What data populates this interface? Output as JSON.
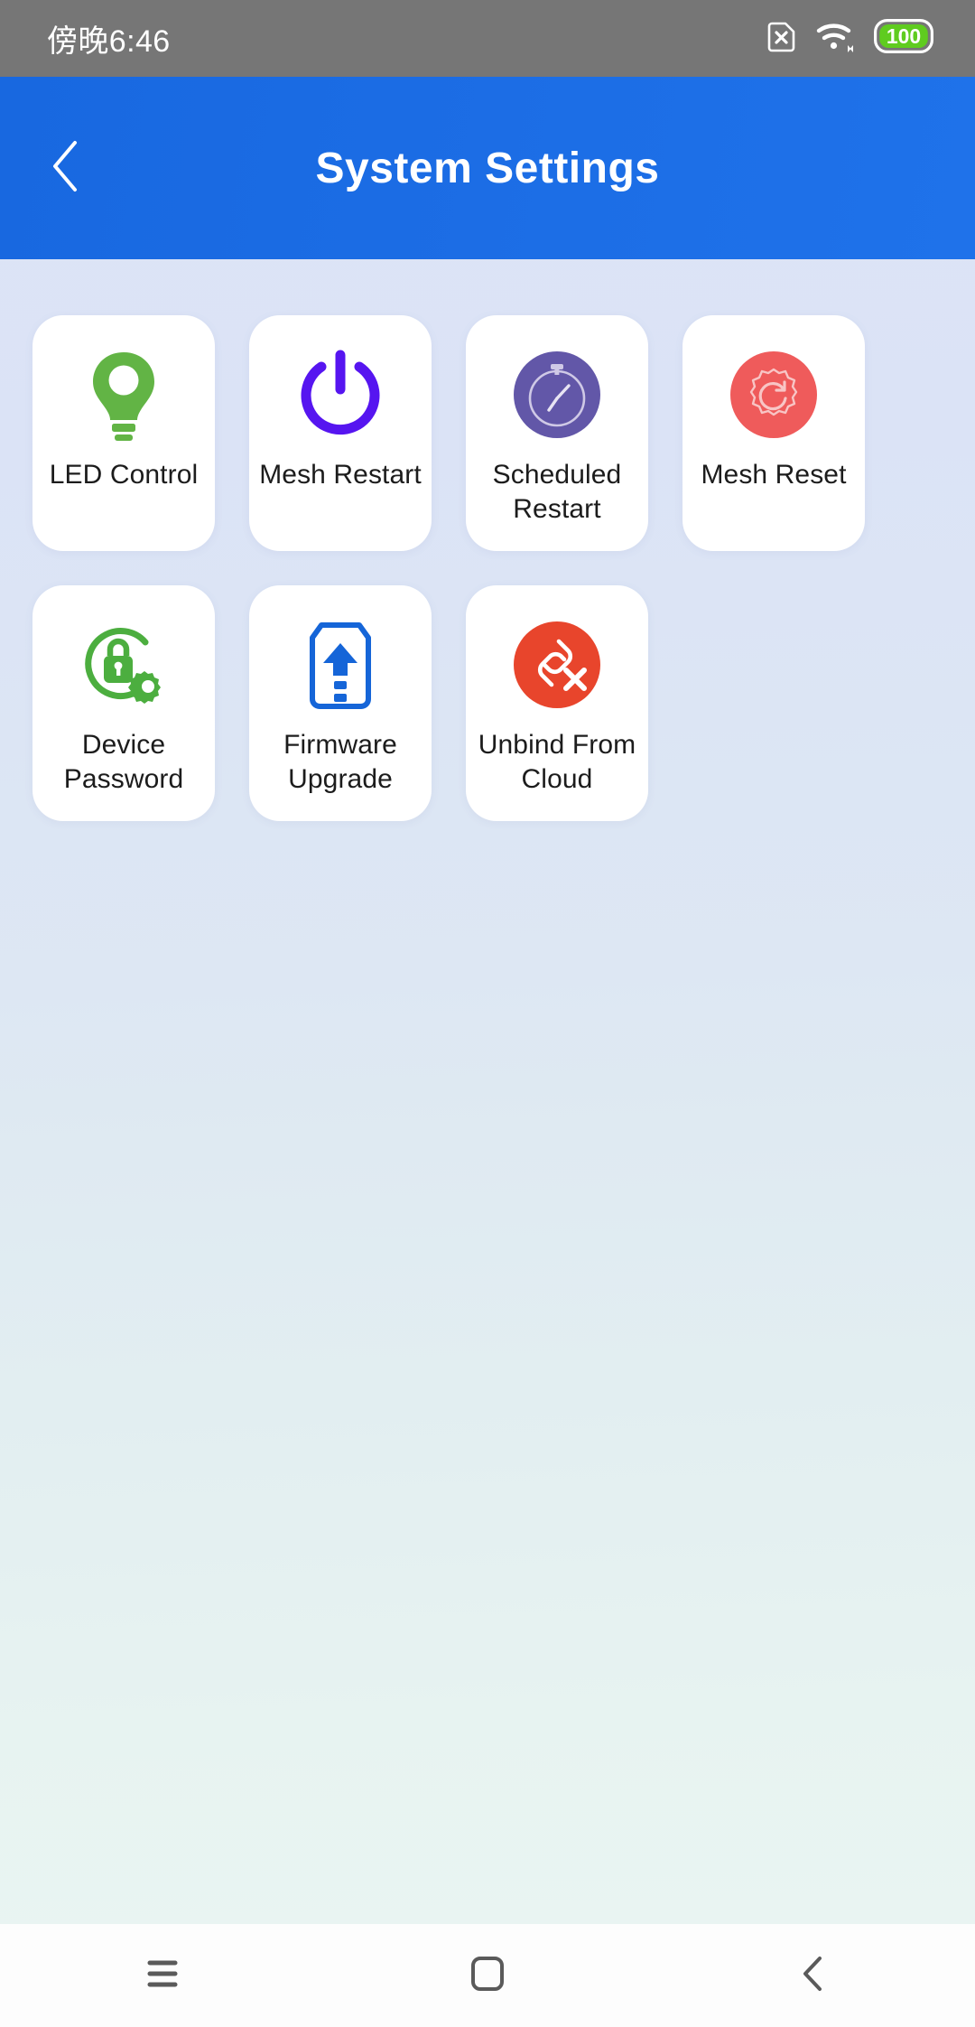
{
  "status_bar": {
    "time": "傍晚6:46",
    "battery_level": "100",
    "icons": [
      "sim-card-off-icon",
      "wifi-icon",
      "battery-icon"
    ],
    "background_color": "#767676",
    "battery_color": "#5fcc1f"
  },
  "header": {
    "title": "System Settings",
    "back_icon": "chevron-left-icon",
    "background_color": "#1b6ce4",
    "title_color": "#ffffff"
  },
  "grid": {
    "tiles": [
      {
        "label": "LED Control",
        "icon": "lightbulb-icon",
        "color": "#62b445"
      },
      {
        "label": "Mesh Restart",
        "icon": "power-icon",
        "color": "#5615f0"
      },
      {
        "label": "Scheduled Restart",
        "icon": "stopwatch-icon",
        "color": "#6257a8"
      },
      {
        "label": "Mesh Reset",
        "icon": "gear-reset-icon",
        "color": "#ef5b5b"
      },
      {
        "label": "Device Password",
        "icon": "lock-gear-icon",
        "color": "#4cae3f"
      },
      {
        "label": "Firmware Upgrade",
        "icon": "firmware-upload-icon",
        "color": "#1565d8"
      },
      {
        "label": "Unbind From Cloud",
        "icon": "broken-link-icon",
        "color": "#e8452c"
      }
    ],
    "card_color": "#ffffff",
    "page_background": "#dde4f6"
  },
  "nav_bar": {
    "buttons": [
      {
        "name": "recents",
        "icon": "menu-icon"
      },
      {
        "name": "home",
        "icon": "home-square-icon"
      },
      {
        "name": "back",
        "icon": "chevron-left-icon"
      }
    ],
    "icon_color": "#5a5a5a",
    "background_color": "#fdfdfd"
  }
}
